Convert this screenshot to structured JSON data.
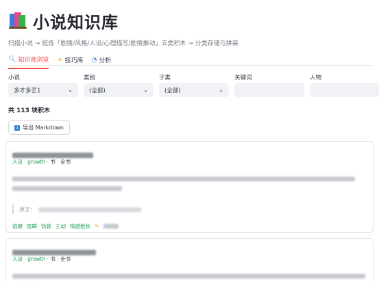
{
  "header": {
    "title": "小说知识库",
    "subtitle": "扫描小说 → 提炼「剧情/风格/人设/心理描写/剧情推动」五类积木 → 分类存储与拼装"
  },
  "tabs": [
    {
      "label": "知识库浏览",
      "icon": "search-icon",
      "active": true
    },
    {
      "label": "技巧库",
      "icon": "lightbulb-icon",
      "active": false
    },
    {
      "label": "分析",
      "icon": "chart-icon",
      "active": false
    }
  ],
  "filters": {
    "novel": {
      "label": "小说",
      "value": "多才多艺1"
    },
    "category": {
      "label": "类别",
      "value": "(全部)"
    },
    "subcategory": {
      "label": "子类",
      "value": "(全部)"
    },
    "keyword": {
      "label": "关键词",
      "value": ""
    },
    "character": {
      "label": "人物",
      "value": ""
    }
  },
  "summary": {
    "count_text": "共 113 块积木"
  },
  "export": {
    "label": "导出 Markdown"
  },
  "cards": [
    {
      "meta_tag": "人设 · growth",
      "meta_rest": " · 书 · 全书",
      "quote_prefix": "原文：",
      "tags": [
        "逃避",
        "隐瞒",
        "伪装",
        "主动",
        "情感纸长"
      ]
    },
    {
      "meta_tag": "人设 · growth",
      "meta_rest": " · 书 · 全书"
    }
  ],
  "colors": {
    "accent": "#ff4b4b",
    "tag_green": "#1f9d55",
    "input_bg": "#f0f2f6"
  }
}
